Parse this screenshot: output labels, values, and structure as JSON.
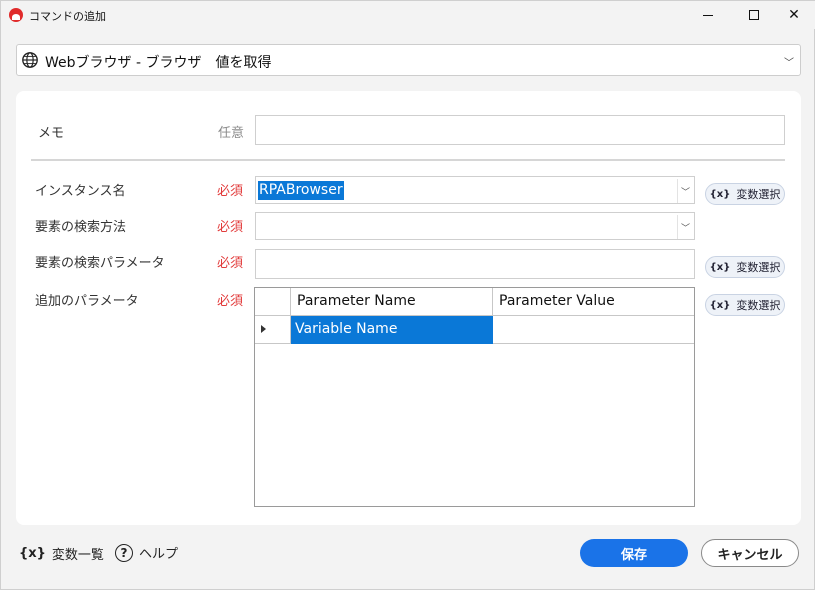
{
  "window": {
    "title": "コマンドの追加"
  },
  "command": {
    "selected": "Webブラウザ - ブラウザ　値を取得"
  },
  "form": {
    "memo": {
      "label": "メモ",
      "tag": "任意",
      "value": ""
    },
    "instance": {
      "label": "インスタンス名",
      "tag": "必須",
      "value": "RPABrowser"
    },
    "search_method": {
      "label": "要素の検索方法",
      "tag": "必須",
      "value": ""
    },
    "search_param": {
      "label": "要素の検索パラメータ",
      "tag": "必須",
      "value": ""
    },
    "extra_params": {
      "label": "追加のパラメータ",
      "tag": "必須"
    },
    "var_select_label": "変数選択",
    "var_icon_text": "{x}"
  },
  "grid": {
    "columns": [
      "Parameter Name",
      "Parameter Value"
    ],
    "rows": [
      {
        "name": "Variable Name",
        "value": ""
      }
    ]
  },
  "footer": {
    "var_list_icon": "{x}",
    "var_list_label": "変数一覧",
    "help_icon": "?",
    "help_label": "ヘルプ",
    "save_label": "保存",
    "cancel_label": "キャンセル"
  },
  "colors": {
    "accent": "#1a73e8",
    "required": "#e23b3b",
    "selection": "#0a78d7"
  }
}
